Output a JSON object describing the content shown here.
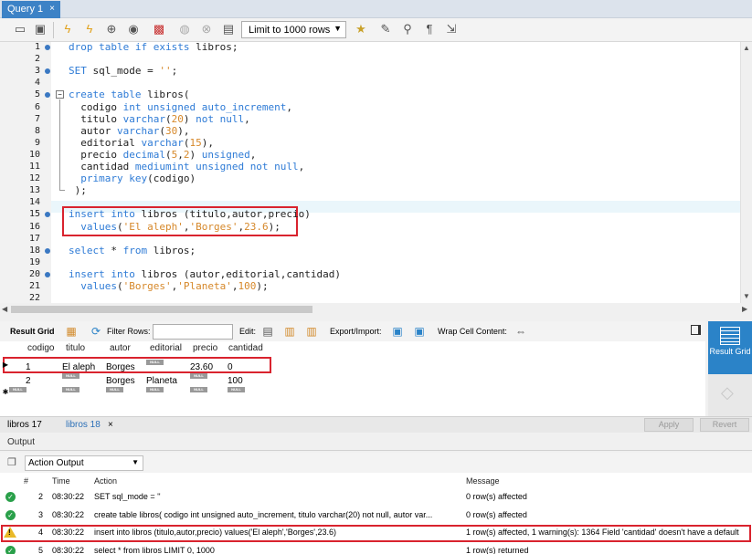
{
  "tab": {
    "title": "Query 1",
    "close": "×"
  },
  "toolbar": {
    "limit": "Limit to 1000 rows"
  },
  "editor": {
    "lines": [
      {
        "n": "1",
        "parts": [
          [
            "kw",
            "drop table if exists "
          ],
          [
            "",
            "libros;"
          ]
        ]
      },
      {
        "n": "2",
        "parts": []
      },
      {
        "n": "3",
        "parts": [
          [
            "kw",
            "SET "
          ],
          [
            "",
            "sql_mode = "
          ],
          [
            "str",
            "''"
          ],
          [
            "",
            ";"
          ]
        ]
      },
      {
        "n": "4",
        "parts": []
      },
      {
        "n": "5",
        "parts": [
          [
            "kw",
            "create table "
          ],
          [
            "",
            "libros("
          ]
        ]
      },
      {
        "n": "6",
        "parts": [
          [
            "",
            "  codigo "
          ],
          [
            "kw",
            "int unsigned auto_increment"
          ],
          [
            "",
            ","
          ]
        ]
      },
      {
        "n": "7",
        "parts": [
          [
            "",
            "  titulo "
          ],
          [
            "kw",
            "varchar"
          ],
          [
            "",
            "("
          ],
          [
            "num",
            "20"
          ],
          [
            "",
            ") "
          ],
          [
            "kw",
            "not null"
          ],
          [
            "",
            ","
          ]
        ]
      },
      {
        "n": "8",
        "parts": [
          [
            "",
            "  autor "
          ],
          [
            "kw",
            "varchar"
          ],
          [
            "",
            "("
          ],
          [
            "num",
            "30"
          ],
          [
            "",
            "),"
          ]
        ]
      },
      {
        "n": "9",
        "parts": [
          [
            "",
            "  editorial "
          ],
          [
            "kw",
            "varchar"
          ],
          [
            "",
            "("
          ],
          [
            "num",
            "15"
          ],
          [
            "",
            "),"
          ]
        ]
      },
      {
        "n": "10",
        "parts": [
          [
            "",
            "  precio "
          ],
          [
            "kw",
            "decimal"
          ],
          [
            "",
            "("
          ],
          [
            "num",
            "5"
          ],
          [
            "",
            ","
          ],
          [
            "num",
            "2"
          ],
          [
            "",
            ") "
          ],
          [
            "kw",
            "unsigned"
          ],
          [
            "",
            ","
          ]
        ]
      },
      {
        "n": "11",
        "parts": [
          [
            "",
            "  cantidad "
          ],
          [
            "kw",
            "mediumint unsigned not null"
          ],
          [
            "",
            ","
          ]
        ]
      },
      {
        "n": "12",
        "parts": [
          [
            "",
            "  "
          ],
          [
            "kw",
            "primary key"
          ],
          [
            "",
            "(codigo)"
          ]
        ]
      },
      {
        "n": "13",
        "parts": [
          [
            "",
            " );"
          ]
        ]
      },
      {
        "n": "14",
        "parts": []
      },
      {
        "n": "15",
        "parts": [
          [
            "kw",
            "insert into "
          ],
          [
            "",
            "libros (titulo,autor,precio)"
          ]
        ]
      },
      {
        "n": "16",
        "parts": [
          [
            "",
            "  "
          ],
          [
            "kw",
            "values"
          ],
          [
            "",
            "("
          ],
          [
            "str",
            "'El aleph'"
          ],
          [
            "",
            ","
          ],
          [
            "str",
            "'Borges'"
          ],
          [
            "",
            ","
          ],
          [
            "num",
            "23.6"
          ],
          [
            "",
            ");"
          ]
        ]
      },
      {
        "n": "17",
        "parts": []
      },
      {
        "n": "18",
        "parts": [
          [
            "kw",
            "select "
          ],
          [
            "",
            "* "
          ],
          [
            "kw",
            "from "
          ],
          [
            "",
            "libros;"
          ]
        ]
      },
      {
        "n": "19",
        "parts": []
      },
      {
        "n": "20",
        "parts": [
          [
            "kw",
            "insert into "
          ],
          [
            "",
            "libros (autor,editorial,cantidad)"
          ]
        ]
      },
      {
        "n": "21",
        "parts": [
          [
            "",
            "  "
          ],
          [
            "kw",
            "values"
          ],
          [
            "",
            "("
          ],
          [
            "str",
            "'Borges'"
          ],
          [
            "",
            ","
          ],
          [
            "str",
            "'Planeta'"
          ],
          [
            "",
            ","
          ],
          [
            "num",
            "100"
          ],
          [
            "",
            ");"
          ]
        ]
      },
      {
        "n": "22",
        "parts": []
      }
    ],
    "dots": [
      "1",
      "3",
      "5",
      "15",
      "18",
      "20"
    ]
  },
  "result": {
    "grid_label": "Result Grid",
    "filter_label": "Filter Rows:",
    "edit_label": "Edit:",
    "export_label": "Export/Import:",
    "wrap_label": "Wrap Cell Content:",
    "side_button": "Result Grid",
    "columns": [
      "codigo",
      "titulo",
      "autor",
      "editorial",
      "precio",
      "cantidad"
    ],
    "rows": [
      [
        "1",
        "El aleph",
        "Borges",
        "NULL",
        "23.60",
        "0"
      ],
      [
        "2",
        "NULL",
        "Borges",
        "Planeta",
        "NULL",
        "100"
      ],
      [
        "NULL",
        "NULL",
        "NULL",
        "NULL",
        "NULL",
        "NULL"
      ]
    ],
    "null_text": "NULL"
  },
  "tabs": {
    "t1": "libros 17",
    "t2": "libros 18",
    "close": "×",
    "apply": "Apply",
    "revert": "Revert"
  },
  "output": {
    "header": "Output",
    "selector": "Action Output",
    "columns": {
      "num": "#",
      "time": "Time",
      "action": "Action",
      "message": "Message"
    },
    "rows": [
      {
        "status": "ok",
        "num": "2",
        "time": "08:30:22",
        "action": "SET sql_mode = ''",
        "message": "0 row(s) affected"
      },
      {
        "status": "ok",
        "num": "3",
        "time": "08:30:22",
        "action": "create table libros(   codigo int unsigned auto_increment,   titulo varchar(20) not null,   autor var...",
        "message": "0 row(s) affected"
      },
      {
        "status": "warn",
        "num": "4",
        "time": "08:30:22",
        "action": "insert into libros (titulo,autor,precio)   values('El aleph','Borges',23.6)",
        "message": "1 row(s) affected, 1 warning(s): 1364 Field 'cantidad' doesn't have a default"
      },
      {
        "status": "ok",
        "num": "5",
        "time": "08:30:22",
        "action": "select * from libros LIMIT 0, 1000",
        "message": "1 row(s) returned"
      }
    ]
  }
}
